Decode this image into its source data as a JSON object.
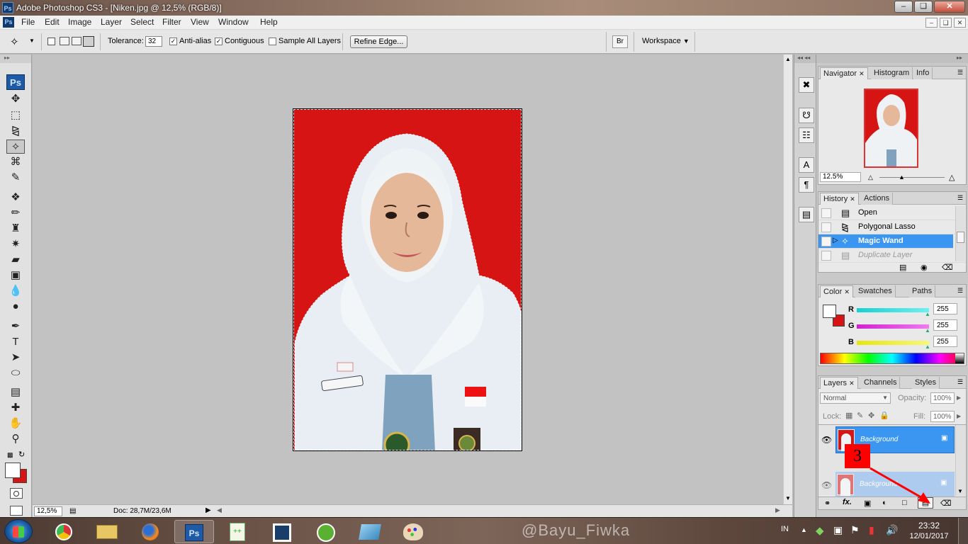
{
  "window": {
    "app_icon": "Ps",
    "title": "Adobe Photoshop CS3 - [Niken.jpg @ 12,5% (RGB/8)]",
    "buttons": [
      "minimize",
      "restore",
      "close"
    ]
  },
  "menu": {
    "doc_icon": "Ps",
    "items": [
      "File",
      "Edit",
      "Image",
      "Layer",
      "Select",
      "Filter",
      "View",
      "Window",
      "Help"
    ]
  },
  "options": {
    "tolerance_label": "Tolerance:",
    "tolerance_value": "32",
    "anti_alias_label": "Anti-alias",
    "anti_alias_checked": true,
    "contiguous_label": "Contiguous",
    "contiguous_checked": true,
    "sample_all_label": "Sample All Layers",
    "sample_all_checked": false,
    "refine_edge_label": "Refine Edge...",
    "workspace_label": "Workspace"
  },
  "toolbox": {
    "ps_badge": "Ps",
    "active_tool": "magic-wand-icon"
  },
  "status": {
    "zoom": "12,5%",
    "doc_size": "Doc: 28,7M/23,6M"
  },
  "navigator": {
    "tabs": [
      "Navigator",
      "Histogram",
      "Info"
    ],
    "zoom_value": "12.5%"
  },
  "history": {
    "tabs": [
      "History",
      "Actions"
    ],
    "items": [
      {
        "label": "Open",
        "icon": "document-icon",
        "state": "normal"
      },
      {
        "label": "Polygonal Lasso",
        "icon": "polygonal-lasso-icon",
        "state": "normal"
      },
      {
        "label": "Magic Wand",
        "icon": "magic-wand-icon",
        "state": "selected"
      },
      {
        "label": "Duplicate Layer",
        "icon": "document-icon",
        "state": "dimmed"
      }
    ]
  },
  "color_panel": {
    "tabs": [
      "Color",
      "Swatches",
      "Paths"
    ],
    "channels": [
      {
        "label": "R",
        "value": "255",
        "color": "#29d6d6"
      },
      {
        "label": "G",
        "value": "255",
        "color": "#e02fe0"
      },
      {
        "label": "B",
        "value": "255",
        "color": "#e8e820"
      }
    ],
    "foreground": "#ffffff",
    "background": "#d71414"
  },
  "layers_panel": {
    "tabs": [
      "Layers",
      "Channels",
      "Styles"
    ],
    "blend_mode": "Normal",
    "opacity_label": "Opacity:",
    "opacity_value": "100%",
    "lock_label": "Lock:",
    "fill_label": "Fill:",
    "fill_value": "100%",
    "layers": [
      {
        "name": "Background",
        "state": "selected"
      },
      {
        "name": "Background",
        "state": "dragging"
      }
    ],
    "annotation_number": "3"
  },
  "taskbar": {
    "watermark": "@Bayu_Fiwka",
    "language": "IN",
    "time": "23:32",
    "date": "12/01/2017"
  },
  "colors": {
    "photo_background": "#d71414",
    "selection_blue": "#3a96f0",
    "annotation_red": "#ff0000"
  }
}
